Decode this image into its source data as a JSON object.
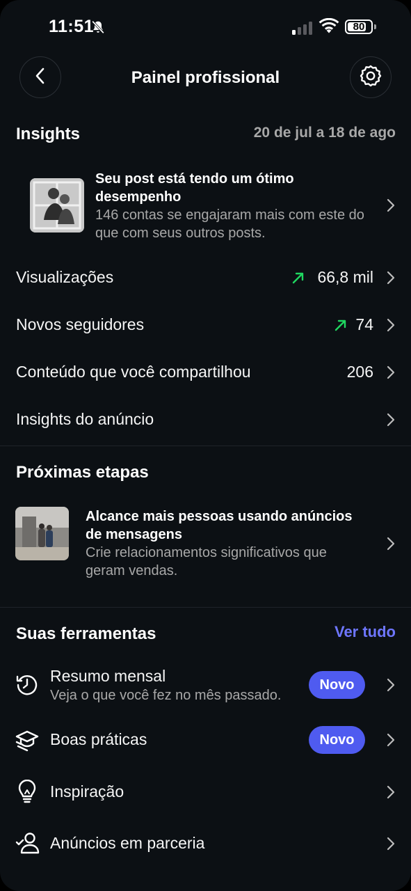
{
  "status_bar": {
    "time": "11:51",
    "battery": "80",
    "battery_level": 0.8,
    "icons": [
      "bell-slash-icon",
      "signal-icon",
      "wifi-icon",
      "battery-icon"
    ]
  },
  "header": {
    "title": "Painel profissional",
    "back_icon": "chevron-left-icon",
    "settings_icon": "gear-icon"
  },
  "insights": {
    "title": "Insights",
    "date_range": "20 de jul a 18 de ago",
    "highlight": {
      "title": "Seu post está tendo um ótimo desempenho",
      "subtitle": "146 contas se engajaram mais com este do que com seus outros posts."
    },
    "metrics": [
      {
        "label": "Visualizações",
        "value": "66,8 mil",
        "trend": "up"
      },
      {
        "label": "Novos seguidores",
        "value": "74",
        "trend": "up"
      },
      {
        "label": "Conteúdo que você compartilhou",
        "value": "206",
        "trend": ""
      },
      {
        "label": "Insights do anúncio",
        "value": "",
        "trend": ""
      }
    ]
  },
  "next_steps": {
    "title": "Próximas etapas",
    "item": {
      "title": "Alcance mais pessoas usando anúncios de mensagens",
      "subtitle": "Crie relacionamentos significativos que geram vendas."
    }
  },
  "tools": {
    "title": "Suas ferramentas",
    "see_all": "Ver tudo",
    "items": [
      {
        "label": "Resumo mensal",
        "subtitle": "Veja o que você fez no mês passado.",
        "badge": "Novo",
        "icon": "history-icon"
      },
      {
        "label": "Boas práticas",
        "subtitle": "",
        "badge": "Novo",
        "icon": "graduation-cap-icon"
      },
      {
        "label": "Inspiração",
        "subtitle": "",
        "badge": "",
        "icon": "lightbulb-icon"
      },
      {
        "label": "Anúncios em parceria",
        "subtitle": "",
        "badge": "",
        "icon": "partner-user-icon"
      }
    ]
  },
  "colors": {
    "background": "#0c1014",
    "accent": "#4f5bf0",
    "link": "#6e76ff",
    "trend_up": "#1fd760",
    "secondary_text": "#a8a8a8"
  }
}
